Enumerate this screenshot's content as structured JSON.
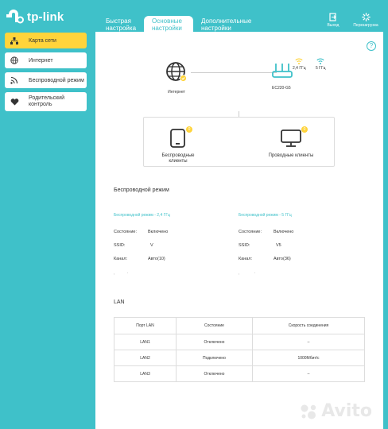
{
  "brand": {
    "name": "tp-link"
  },
  "header": {
    "tabs": [
      {
        "line1": "Быстрая",
        "line2": "настройка"
      },
      {
        "line1": "Основные",
        "line2": "настройки"
      },
      {
        "line1": "Дополнительные",
        "line2": "настройки"
      }
    ],
    "logout": "Выход",
    "reboot": "Перезагрузка"
  },
  "sidebar": {
    "items": [
      {
        "label": "Карта сети"
      },
      {
        "label": "Интернет"
      },
      {
        "label": "Беспроводной режим"
      },
      {
        "label_line1": "Родительский",
        "label_line2": "контроль"
      }
    ]
  },
  "topology": {
    "internet_label": "Интернет",
    "router_label": "EC220-G5",
    "band_24": "2,4 ГГц",
    "band_5": "5 ГГц",
    "wireless_clients_line1": "Беспроводные",
    "wireless_clients_line2": "клиенты",
    "wireless_clients_count": "0",
    "wired_clients": "Проводные клиенты",
    "wired_clients_count": "0"
  },
  "wireless": {
    "title": "Беспроводной режим",
    "band_24": {
      "heading": "Беспроводной режим - 2,4 ГГц",
      "state_label": "Состояние:",
      "state_value": "Включено",
      "ssid_label": "SSID:",
      "ssid_value": "V",
      "channel_label": "Канал:",
      "channel_value": "Авто(10)"
    },
    "band_5": {
      "heading": "Беспроводной режим - 5 ГГц",
      "state_label": "Состояние:",
      "state_value": "Включено",
      "ssid_label": "SSID:",
      "ssid_value": "V5",
      "channel_label": "Канал:",
      "channel_value": "Авто(36)"
    }
  },
  "lan": {
    "title": "LAN",
    "columns": [
      "Порт LAN",
      "Состояние",
      "Скорость соединения"
    ],
    "rows": [
      [
        "LAN1",
        "Отключено",
        "–"
      ],
      [
        "LAN2",
        "Подключено",
        "1000Мбит/с"
      ],
      [
        "LAN3",
        "Отключено",
        "–"
      ]
    ]
  },
  "watermark": {
    "text": "Avito"
  },
  "colors": {
    "teal": "#3fc1c9",
    "accent": "#ffd43b"
  }
}
